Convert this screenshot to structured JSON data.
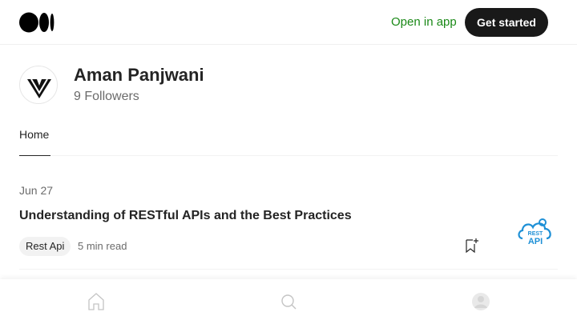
{
  "header": {
    "open_in_app": "Open in app",
    "get_started": "Get started"
  },
  "author": {
    "name": "Aman Panjwani",
    "followers": "9 Followers"
  },
  "tabs": [
    {
      "label": "Home",
      "active": true
    }
  ],
  "posts": [
    {
      "date": "Jun 27",
      "title": "Understanding of RESTful APIs and the Best Practices",
      "tag": "Rest Api",
      "read_time": "5 min read",
      "thumbnail_text": [
        "REST",
        "API"
      ]
    }
  ],
  "bottom_nav": {
    "icons": [
      "home-icon",
      "search-icon",
      "profile-icon"
    ]
  },
  "colors": {
    "accent_green": "#1a8917",
    "dark_button": "#191919",
    "thumbnail_blue": "#1e90d6"
  }
}
